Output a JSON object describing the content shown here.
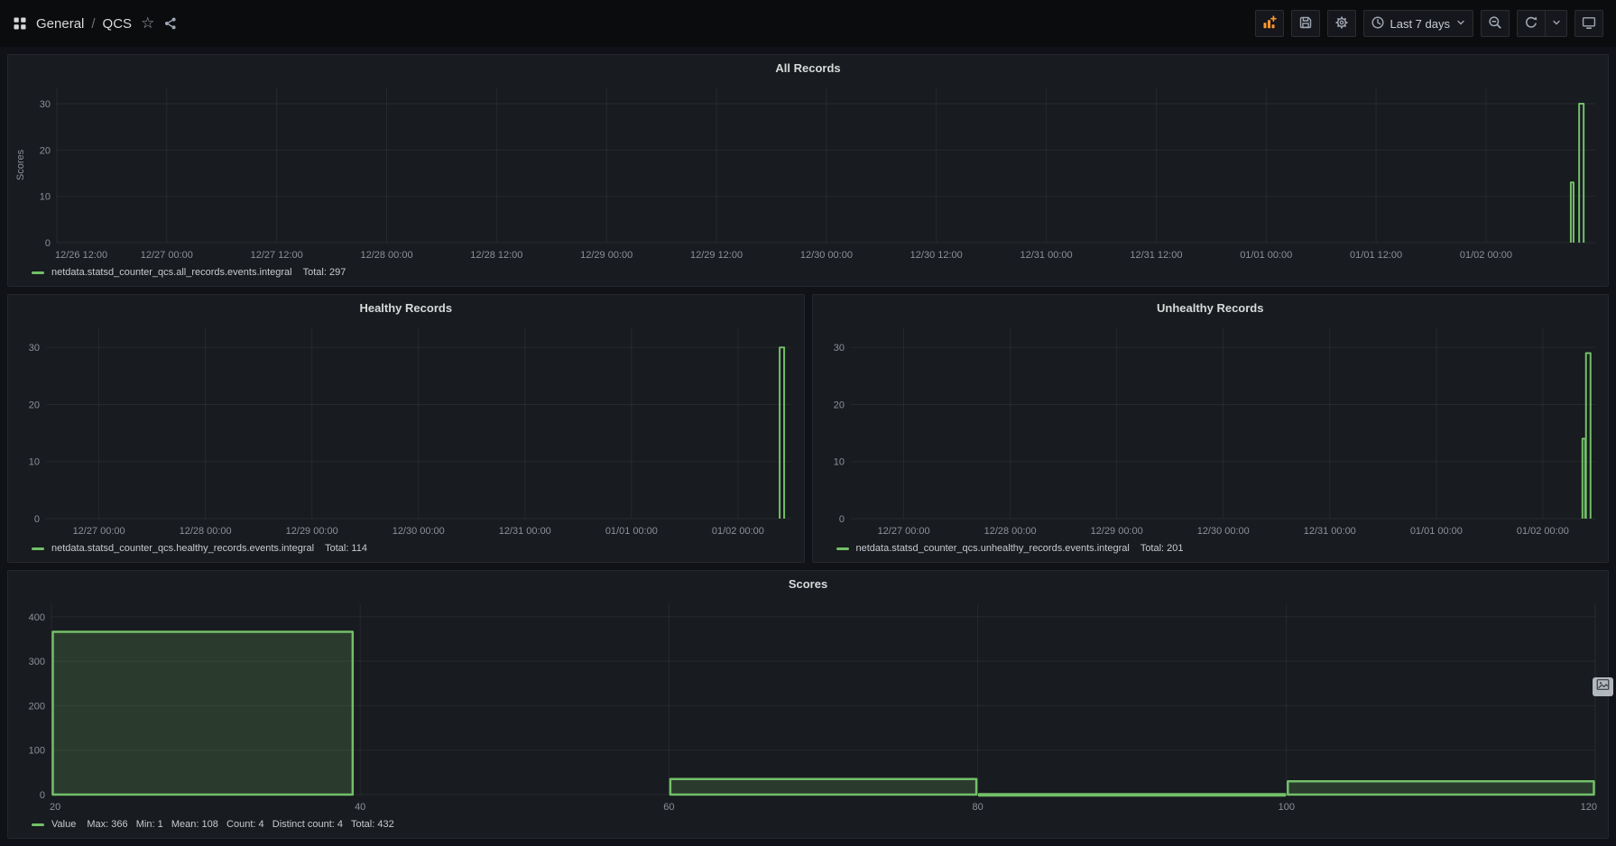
{
  "theme": {
    "green": "#73bf69",
    "orange": "#ff9830"
  },
  "topbar": {
    "breadcrumb": {
      "folder": "General",
      "separator": "/",
      "dashboard": "QCS"
    },
    "time_range": "Last 7 days"
  },
  "panels": [
    {
      "title": "All Records",
      "legend_series": "netdata.statsd_counter_qcs.all_records.events.integral",
      "legend_stats": "Total: 297"
    },
    {
      "title": "Healthy Records",
      "legend_series": "netdata.statsd_counter_qcs.healthy_records.events.integral",
      "legend_stats": "Total: 114"
    },
    {
      "title": "Unhealthy Records",
      "legend_series": "netdata.statsd_counter_qcs.unhealthy_records.events.integral",
      "legend_stats": "Total: 201"
    },
    {
      "title": "Scores",
      "legend_series": "Value",
      "legend_stats": "Max: 366   Min: 1   Mean: 108   Count: 4   Distinct count: 4   Total: 432"
    }
  ],
  "chart_data": [
    {
      "type": "line",
      "title": "All Records",
      "ylabel": "Scores",
      "ymax": 33.5,
      "yticks": [
        0,
        10,
        20,
        30
      ],
      "xticks": [
        "12/26 12:00",
        "12/27 00:00",
        "12/27 12:00",
        "12/28 00:00",
        "12/28 12:00",
        "12/29 00:00",
        "12/29 12:00",
        "12/30 00:00",
        "12/30 12:00",
        "12/31 00:00",
        "12/31 12:00",
        "01/01 00:00",
        "01/01 12:00",
        "01/02 00:00"
      ],
      "x_layout": {
        "first_frac": 0.0,
        "last_frac": 0.929,
        "margin_left": 48
      },
      "grid": true,
      "legend_position": "bottom-left",
      "series": [
        {
          "name": "netdata.statsd_counter_qcs.all_records.events.integral",
          "color": "#73bf69",
          "total": 297,
          "pulses": [
            {
              "x_frac": 0.985,
              "value": 13,
              "width": 3
            },
            {
              "x_frac": 0.991,
              "value": 30,
              "width": 5
            }
          ]
        }
      ]
    },
    {
      "type": "line",
      "title": "Healthy Records",
      "ylabel": "",
      "ymax": 33.5,
      "yticks": [
        0,
        10,
        20,
        30
      ],
      "xticks": [
        "12/27 00:00",
        "12/28 00:00",
        "12/29 00:00",
        "12/30 00:00",
        "12/31 00:00",
        "01/01 00:00",
        "01/02 00:00"
      ],
      "x_layout": {
        "first_frac": 0.071,
        "last_frac": 0.929,
        "margin_left": 36
      },
      "grid": true,
      "legend_position": "bottom-left",
      "series": [
        {
          "name": "netdata.statsd_counter_qcs.healthy_records.events.integral",
          "color": "#73bf69",
          "total": 114,
          "pulses": [
            {
              "x_frac": 0.988,
              "value": 30,
              "width": 5
            }
          ]
        }
      ]
    },
    {
      "type": "line",
      "title": "Unhealthy Records",
      "ylabel": "",
      "ymax": 33.5,
      "yticks": [
        0,
        10,
        20,
        30
      ],
      "xticks": [
        "12/27 00:00",
        "12/28 00:00",
        "12/29 00:00",
        "12/30 00:00",
        "12/31 00:00",
        "01/01 00:00",
        "01/02 00:00"
      ],
      "x_layout": {
        "first_frac": 0.071,
        "last_frac": 0.929,
        "margin_left": 36
      },
      "grid": true,
      "legend_position": "bottom-left",
      "series": [
        {
          "name": "netdata.statsd_counter_qcs.unhealthy_records.events.integral",
          "color": "#73bf69",
          "total": 201,
          "pulses": [
            {
              "x_frac": 0.984,
              "value": 14,
              "width": 3
            },
            {
              "x_frac": 0.99,
              "value": 29,
              "width": 5
            }
          ]
        }
      ]
    },
    {
      "type": "bar",
      "title": "Scores",
      "ymax": 430,
      "yticks": [
        0,
        100,
        200,
        300,
        400
      ],
      "xlim": [
        20,
        120
      ],
      "xticks": [
        20,
        40,
        60,
        80,
        100,
        120
      ],
      "x_layout": {
        "margin_left": 42
      },
      "grid": true,
      "legend_position": "bottom-left",
      "series": [
        {
          "name": "Value",
          "color": "#73bf69",
          "stats": {
            "max": 366,
            "min": 1,
            "mean": 108,
            "count": 4,
            "distinct_count": 4,
            "total": 432
          }
        }
      ],
      "bars": [
        {
          "x0": 20,
          "x1": 39.6,
          "value": 366
        },
        {
          "x0": 60,
          "x1": 80,
          "value": 35
        },
        {
          "x0": 80,
          "x1": 100,
          "value": 1
        },
        {
          "x0": 100,
          "x1": 120,
          "value": 30
        }
      ]
    }
  ]
}
